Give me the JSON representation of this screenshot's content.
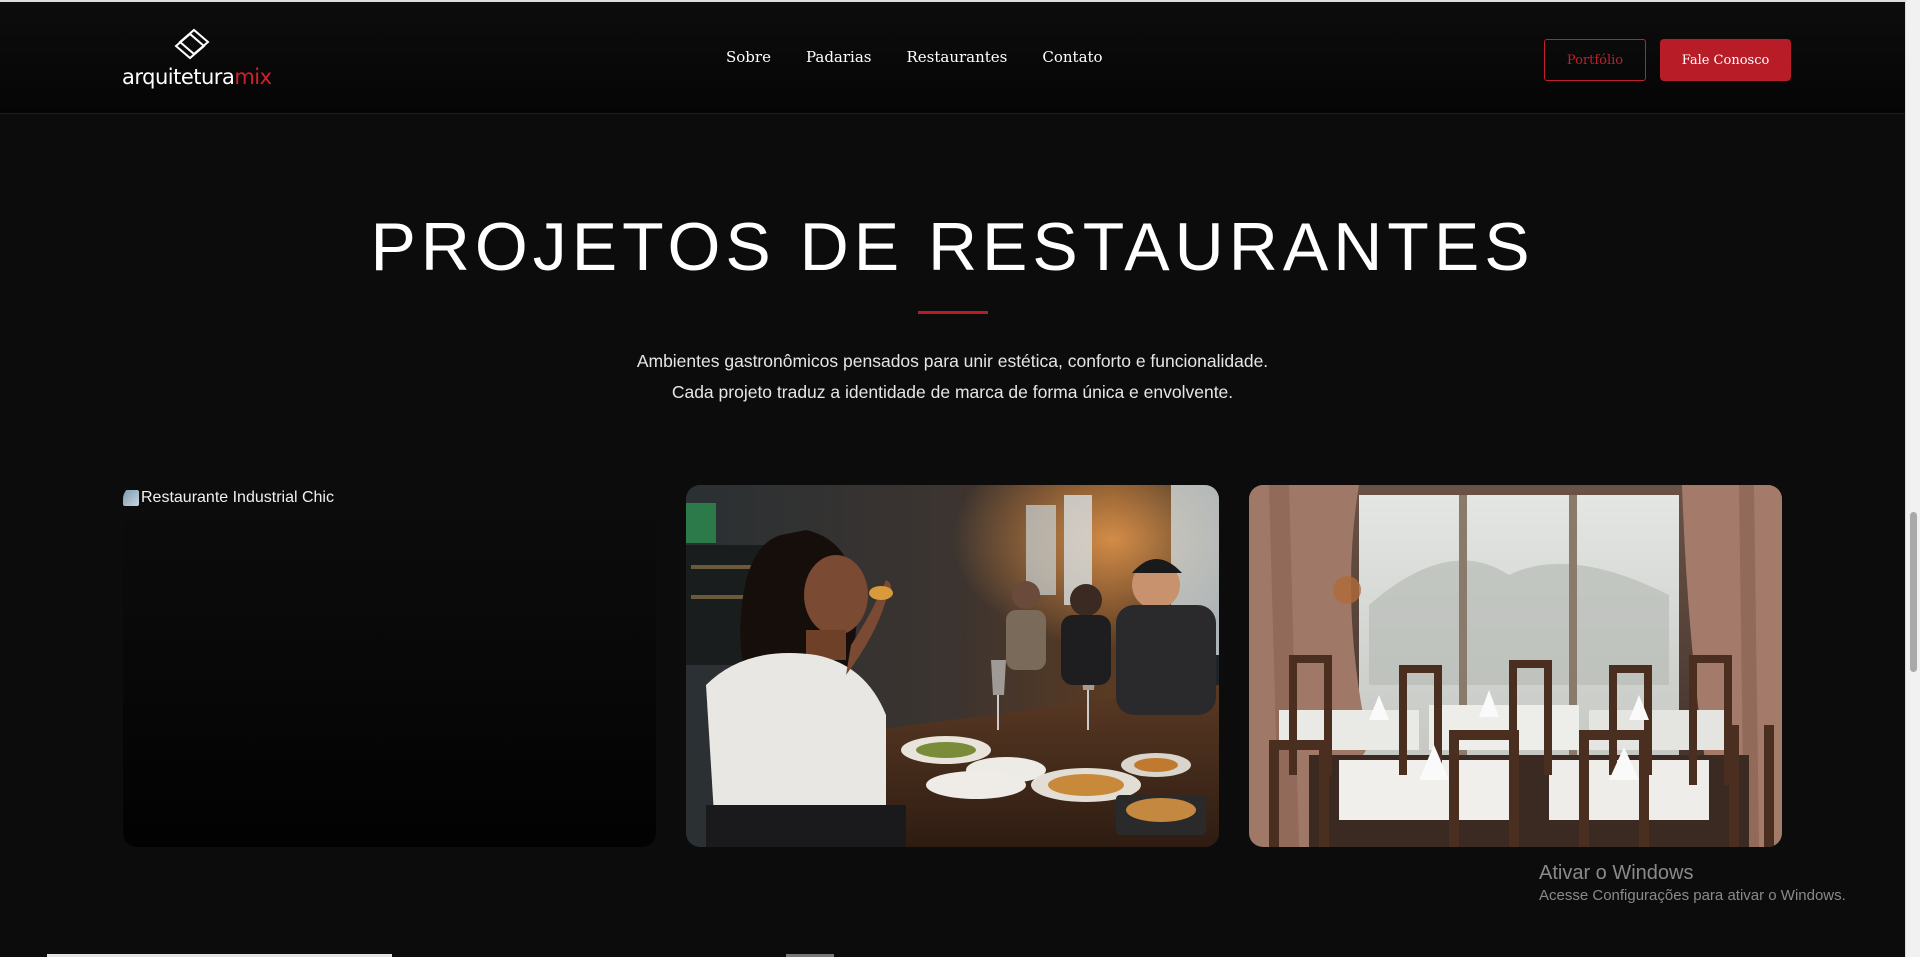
{
  "header": {
    "logo": {
      "text_main": "arquitetura",
      "text_accent": "mix"
    },
    "nav": [
      {
        "label": "Sobre"
      },
      {
        "label": "Padarias"
      },
      {
        "label": "Restaurantes"
      },
      {
        "label": "Contato"
      }
    ],
    "portfolio_button": "Portfólio",
    "contact_button": "Fale Conosco"
  },
  "section": {
    "title": "PROJETOS DE RESTAURANTES",
    "description_line1": "Ambientes gastronômicos pensados para unir estética, conforto e funcionalidade.",
    "description_line2": "Cada projeto traduz a identidade de marca de forma única e envolvente."
  },
  "projects": [
    {
      "alt": "Restaurante Industrial Chic",
      "image": "broken-image"
    },
    {
      "image": "woman-eating-at-restaurant-photo"
    },
    {
      "image": "dining-room-with-curtains-photo"
    }
  ],
  "watermark": {
    "title": "Ativar o Windows",
    "subtitle": "Acesse Configurações para ativar o Windows."
  },
  "colors": {
    "accent": "#b71c27",
    "background": "#0c0c0c"
  }
}
